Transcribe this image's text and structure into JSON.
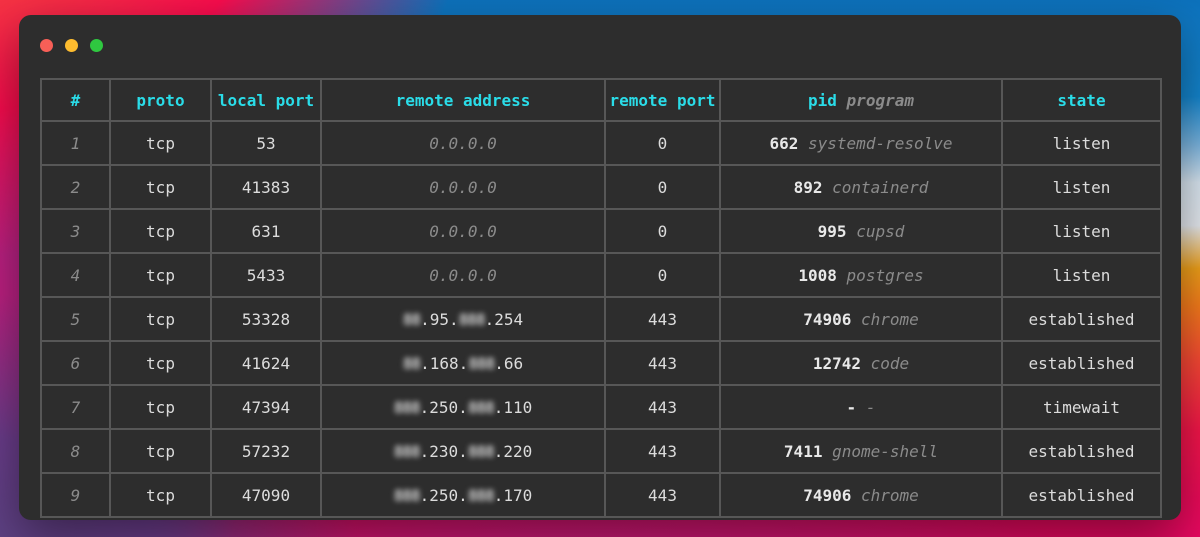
{
  "window": {
    "controls": [
      {
        "name": "close",
        "color": "#f85f57"
      },
      {
        "name": "minimize",
        "color": "#fdbc2f"
      },
      {
        "name": "maximize",
        "color": "#2fc840"
      }
    ]
  },
  "table": {
    "headers": {
      "index": "#",
      "proto": "proto",
      "local_port": "local port",
      "remote_address": "remote address",
      "remote_port": "remote port",
      "pid": "pid",
      "program": "program",
      "state": "state"
    },
    "rows": [
      {
        "index": "1",
        "proto": "tcp",
        "local_port": "53",
        "remote": [
          {
            "t": "0.0.0.0",
            "muted": true
          }
        ],
        "remote_port": "0",
        "pid": "662",
        "program": "systemd-resolve",
        "state": "listen"
      },
      {
        "index": "2",
        "proto": "tcp",
        "local_port": "41383",
        "remote": [
          {
            "t": "0.0.0.0",
            "muted": true
          }
        ],
        "remote_port": "0",
        "pid": "892",
        "program": "containerd",
        "state": "listen"
      },
      {
        "index": "3",
        "proto": "tcp",
        "local_port": "631",
        "remote": [
          {
            "t": "0.0.0.0",
            "muted": true
          }
        ],
        "remote_port": "0",
        "pid": "995",
        "program": "cupsd",
        "state": "listen"
      },
      {
        "index": "4",
        "proto": "tcp",
        "local_port": "5433",
        "remote": [
          {
            "t": "0.0.0.0",
            "muted": true
          }
        ],
        "remote_port": "0",
        "pid": "1008",
        "program": "postgres",
        "state": "listen"
      },
      {
        "index": "5",
        "proto": "tcp",
        "local_port": "53328",
        "remote": [
          {
            "t": "88",
            "blur": true
          },
          {
            "t": ".95."
          },
          {
            "t": "888",
            "blur": true
          },
          {
            "t": ".254"
          }
        ],
        "remote_port": "443",
        "pid": "74906",
        "program": "chrome",
        "state": "established"
      },
      {
        "index": "6",
        "proto": "tcp",
        "local_port": "41624",
        "remote": [
          {
            "t": "88",
            "blur": true
          },
          {
            "t": ".168."
          },
          {
            "t": "888",
            "blur": true
          },
          {
            "t": ".66"
          }
        ],
        "remote_port": "443",
        "pid": "12742",
        "program": "code",
        "state": "established"
      },
      {
        "index": "7",
        "proto": "tcp",
        "local_port": "47394",
        "remote": [
          {
            "t": "888",
            "blur": true
          },
          {
            "t": ".250."
          },
          {
            "t": "888",
            "blur": true
          },
          {
            "t": ".110"
          }
        ],
        "remote_port": "443",
        "pid": "-",
        "program": "-",
        "state": "timewait"
      },
      {
        "index": "8",
        "proto": "tcp",
        "local_port": "57232",
        "remote": [
          {
            "t": "888",
            "blur": true
          },
          {
            "t": ".230."
          },
          {
            "t": "888",
            "blur": true
          },
          {
            "t": ".220"
          }
        ],
        "remote_port": "443",
        "pid": "7411",
        "program": "gnome-shell",
        "state": "established"
      },
      {
        "index": "9",
        "proto": "tcp",
        "local_port": "47090",
        "remote": [
          {
            "t": "888",
            "blur": true
          },
          {
            "t": ".250."
          },
          {
            "t": "888",
            "blur": true
          },
          {
            "t": ".170"
          }
        ],
        "remote_port": "443",
        "pid": "74906",
        "program": "chrome",
        "state": "established"
      }
    ]
  },
  "colors": {
    "accent_cyan": "#2adce8",
    "muted_gray": "#8b8b8b",
    "text": "#dcdcdc",
    "border": "#575757",
    "window_bg": "#2d2d2d"
  }
}
